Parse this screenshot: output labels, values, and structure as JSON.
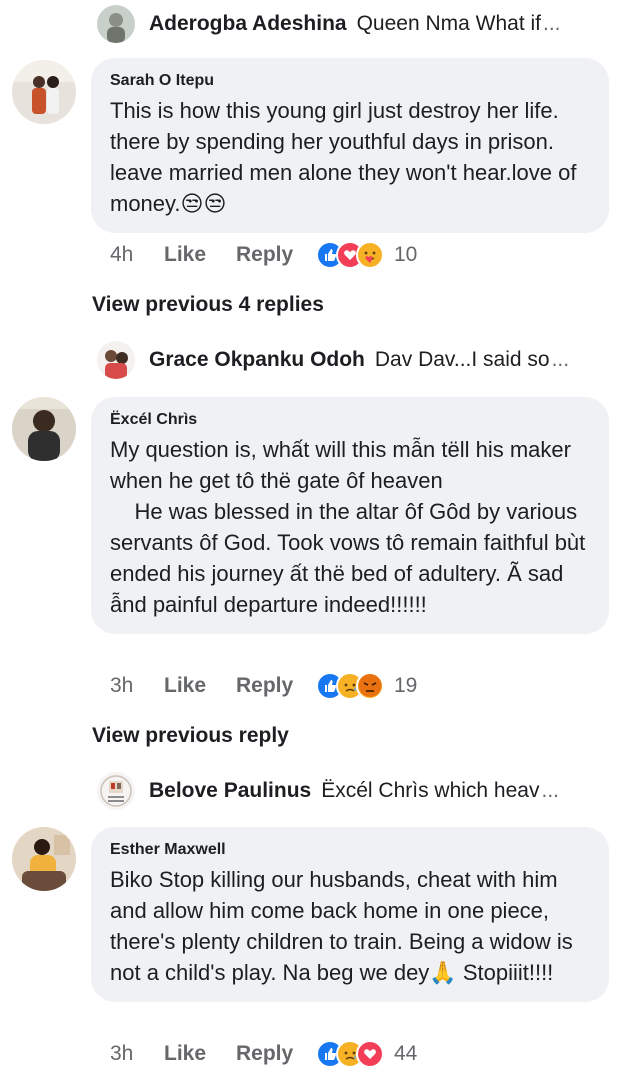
{
  "replies_preview": [
    {
      "name": "Aderogba Adeshina",
      "snippet": "Queen Nma What if",
      "ellipsis": "..."
    },
    {
      "name": "Grace Okpanku Odoh",
      "snippet": "Dav Dav...I said so",
      "ellipsis": "..."
    },
    {
      "name": "Belove Paulinus",
      "snippet": "Ëxcél Chrìs which heav",
      "ellipsis": "..."
    }
  ],
  "comments": [
    {
      "name": "Sarah O Itepu",
      "text": "This is how this young girl just destroy her life. there by spending her youthful days in prison. leave married men alone they won't hear.love of money.😒😒",
      "time": "4h",
      "like_label": "Like",
      "reply_label": "Reply",
      "reactions": [
        "like-icon",
        "love-icon",
        "care-icon"
      ],
      "reaction_count": "10"
    },
    {
      "name": "Ëxcél Chrìs",
      "text": "My question is, whất will this mẫn tëll his maker when he get tô thë gate ôf heaven\n    He was blessed in the altar ôf Gôd by various servants ôf God. Took vows tô remain faithful bùt ended his journey ất thë bed of adultery. Ã sad ẫnd painful departure indeed!!!!!!",
      "time": "3h",
      "like_label": "Like",
      "reply_label": "Reply",
      "reactions": [
        "like-icon",
        "sad-icon",
        "angry-icon"
      ],
      "reaction_count": "19"
    },
    {
      "name": "Esther Maxwell",
      "text": "Biko Stop killing our husbands, cheat with him and allow him come back home in one piece, there's plenty children to train. Being a widow is not a child's play. Na beg we dey🙏 Stopiiit!!!!",
      "time": "3h",
      "like_label": "Like",
      "reply_label": "Reply",
      "reactions": [
        "like-icon",
        "sad-icon",
        "love-icon"
      ],
      "reaction_count": "44"
    }
  ],
  "view_previous": [
    {
      "label": "View previous 4 replies"
    },
    {
      "label": "View previous reply"
    }
  ],
  "colors": {
    "bubble": "#eff1f4",
    "text": "#1c1e21",
    "muted": "#65676b",
    "like_blue": "#1877f2",
    "love_red": "#f33e58",
    "emoji_yellow": "#f7b125"
  }
}
